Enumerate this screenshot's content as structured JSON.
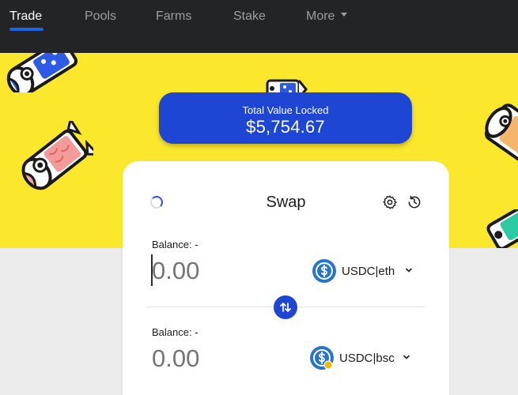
{
  "nav": {
    "items": [
      {
        "label": "Trade",
        "active": true
      },
      {
        "label": "Pools",
        "active": false
      },
      {
        "label": "Farms",
        "active": false
      },
      {
        "label": "Stake",
        "active": false
      },
      {
        "label": "More",
        "active": false
      }
    ]
  },
  "tvl": {
    "label": "Total Value Locked",
    "value": "$5,754.67"
  },
  "swap": {
    "title": "Swap",
    "from": {
      "balance_label": "Balance: -",
      "amount_placeholder": "0.00",
      "token": "USDC|eth"
    },
    "to": {
      "balance_label": "Balance: -",
      "amount_placeholder": "0.00",
      "token": "USDC|bsc"
    }
  },
  "icons": {
    "settings": "gear-icon",
    "history": "history-icon",
    "switch": "swap-arrows-icon",
    "loading": "loading-spinner-icon"
  },
  "colors": {
    "nav_bg": "#232425",
    "accent": "#1e45d4",
    "hero_bg": "#fbe82d",
    "page_bg": "#ebebeb"
  }
}
